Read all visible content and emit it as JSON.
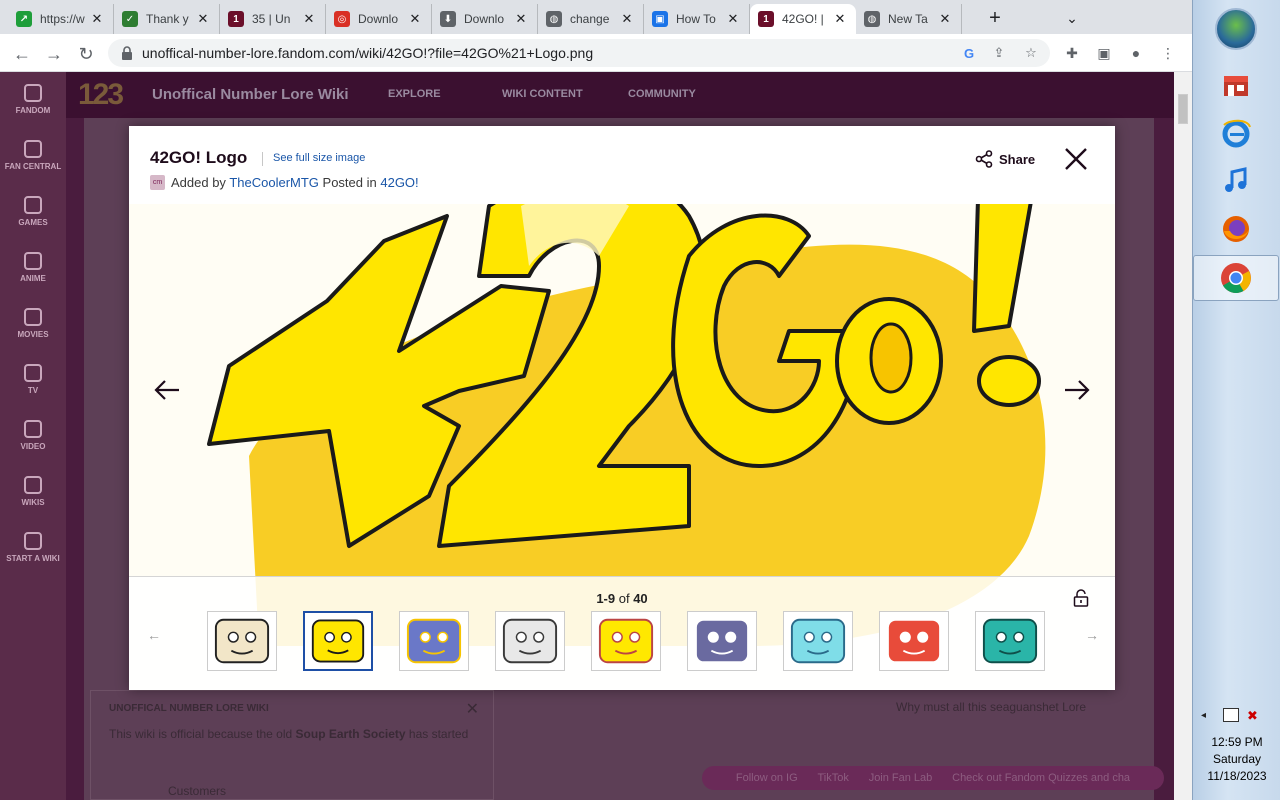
{
  "browser": {
    "tabs": [
      {
        "title": "https://w",
        "favicon_color": "#1e9e3a",
        "favicon_glyph": "↗"
      },
      {
        "title": "Thank y",
        "favicon_color": "#2e7d32",
        "favicon_glyph": "✓"
      },
      {
        "title": "35 | Un",
        "favicon_color": "#6b0f2a",
        "favicon_glyph": "1"
      },
      {
        "title": "Downlo",
        "favicon_color": "#d93025",
        "favicon_glyph": "◎"
      },
      {
        "title": "Downlo",
        "favicon_color": "#5f6368",
        "favicon_glyph": "⬇"
      },
      {
        "title": "change",
        "favicon_color": "#5f6368",
        "favicon_glyph": "◍"
      },
      {
        "title": "How To",
        "favicon_color": "#1a73e8",
        "favicon_glyph": "▣"
      },
      {
        "title": "42GO! |",
        "favicon_color": "#6b0f2a",
        "favicon_glyph": "1"
      },
      {
        "title": "New Ta",
        "favicon_color": "#5f6368",
        "favicon_glyph": "◍"
      }
    ],
    "active_tab_index": 7,
    "new_tab_label": "+",
    "url": "unoffical-number-lore.fandom.com/wiki/42GO!?file=42GO%21+Logo.png"
  },
  "page": {
    "site_logo": "123",
    "wiki_name": "Unoffical Number Lore Wiki",
    "nav": [
      "EXPLORE",
      "WIKI CONTENT",
      "COMMUNITY"
    ],
    "rail": [
      "FANDOM",
      "FAN CENTRAL",
      "GAMES",
      "ANIME",
      "MOVIES",
      "TV",
      "VIDEO",
      "WIKIS",
      "START A WIKI"
    ],
    "notice_title": "UNOFFICAL NUMBER LORE WIKI",
    "notice_text_prefix": "This wiki is official because the old ",
    "notice_text_bold": "Soup Earth Society",
    "notice_text_suffix": " has started",
    "customers_label": "Customers",
    "sidebar_text": "Why must all this seaguanshet Lore",
    "footer_links": [
      "Follow on IG",
      "TikTok",
      "Join Fan Lab",
      "Check out Fandom Quizzes and cha"
    ]
  },
  "lightbox": {
    "title": "42GO! Logo",
    "full_size_link": "See full size image",
    "added_by_prefix": "Added by",
    "author": "TheCoolerMTG",
    "posted_in_prefix": "Posted in",
    "posted_in": "42GO!",
    "avatar_text": "cm",
    "share_label": "Share",
    "count_range": "1-9",
    "count_of": "of",
    "count_total": "40",
    "thumbnails": [
      "thumb-1",
      "thumb-2",
      "thumb-3",
      "thumb-4",
      "thumb-5",
      "thumb-6",
      "thumb-7",
      "thumb-8",
      "thumb-9"
    ],
    "selected_thumbnail": 1
  },
  "taskbar": {
    "clock_time": "12:59 PM",
    "clock_day": "Saturday",
    "clock_date": "11/18/2023"
  },
  "colors": {
    "logo_yellow": "#ffe600",
    "logo_gold": "#f7c400",
    "link_blue": "#1a56a8",
    "fandom_bg": "#4a1c3e"
  }
}
